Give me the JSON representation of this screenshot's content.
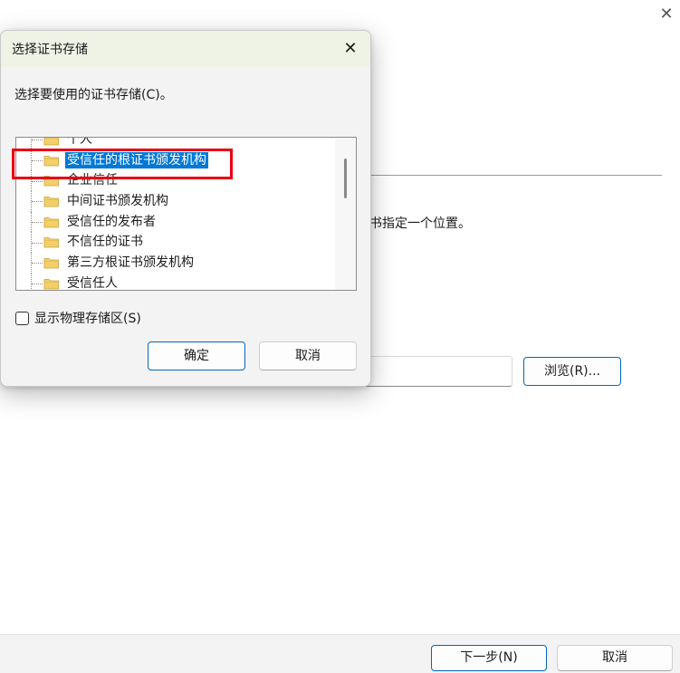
{
  "wizard": {
    "close_glyph": "✕",
    "partial_text": "书指定一个位置。",
    "browse_label": "浏览(R)...",
    "next_label": "下一步(N)",
    "cancel_label": "取消"
  },
  "dialog": {
    "title": "选择证书存储",
    "close_glyph": "✕",
    "prompt": "选择要使用的证书存储(C)。",
    "tree_items": [
      {
        "label": "个人",
        "selected": false
      },
      {
        "label": "受信任的根证书颁发机构",
        "selected": true
      },
      {
        "label": "企业信任",
        "selected": false
      },
      {
        "label": "中间证书颁发机构",
        "selected": false
      },
      {
        "label": "受信任的发布者",
        "selected": false
      },
      {
        "label": "不信任的证书",
        "selected": false
      },
      {
        "label": "第三方根证书颁发机构",
        "selected": false
      },
      {
        "label": "受信任人",
        "selected": false
      }
    ],
    "show_physical_label": "显示物理存储区(S)",
    "show_physical_checked": false,
    "ok_label": "确定",
    "cancel_label": "取消"
  },
  "colors": {
    "accent": "#0078d7",
    "highlight_box": "#e60012",
    "folder": "#f3cf6a"
  },
  "icons": [
    "close-icon",
    "folder-icon",
    "checkbox"
  ]
}
